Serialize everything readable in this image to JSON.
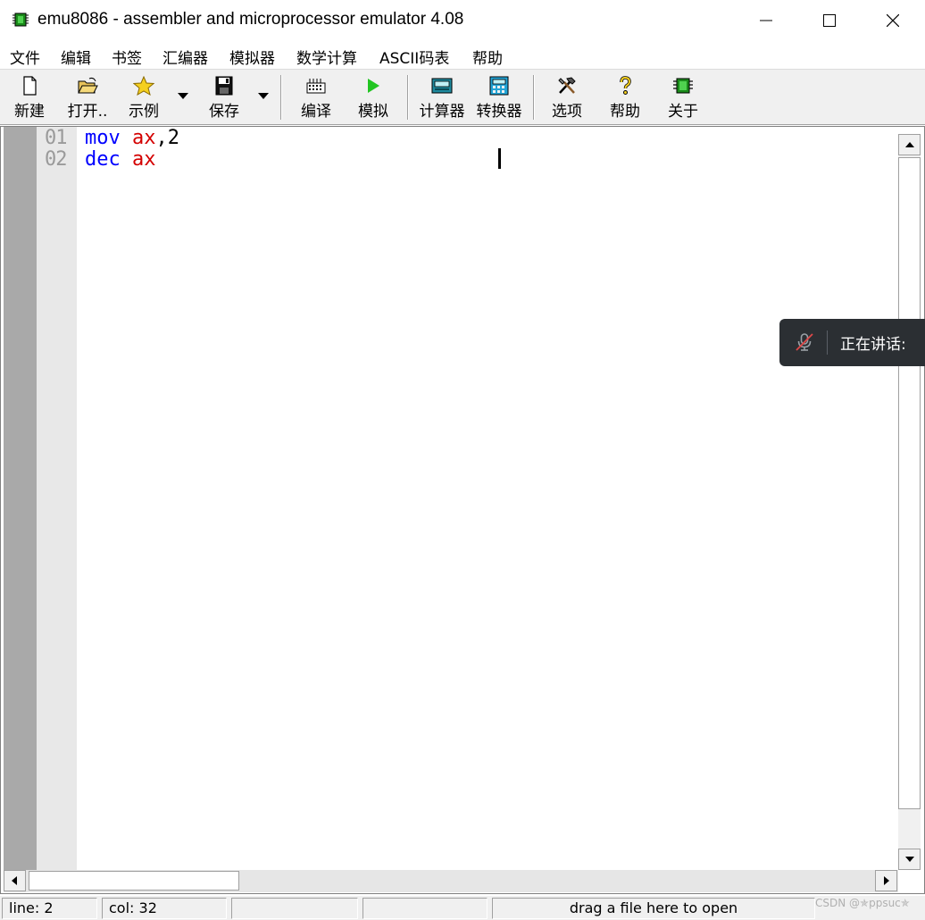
{
  "window": {
    "title": "emu8086 - assembler and microprocessor emulator 4.08"
  },
  "menu": {
    "items": [
      "文件",
      "编辑",
      "书签",
      "汇编器",
      "模拟器",
      "数学计算",
      "ASCII码表",
      "帮助"
    ]
  },
  "toolbar": {
    "new_label": "新建",
    "open_label": "打开..",
    "examples_label": "示例",
    "save_label": "保存",
    "compile_label": "编译",
    "emulate_label": "模拟",
    "calculator_label": "计算器",
    "converter_label": "转换器",
    "options_label": "选项",
    "help_label": "帮助",
    "about_label": "关于"
  },
  "editor": {
    "line_numbers": [
      "01",
      "02"
    ],
    "lines": [
      {
        "keyword": "mov",
        "register": "ax",
        "rest": ",2"
      },
      {
        "keyword": "dec",
        "register": "ax",
        "rest": ""
      }
    ]
  },
  "status": {
    "line": "line: 2",
    "col": "col: 32",
    "hint": "drag a file here to open"
  },
  "overlay": {
    "speaking_text": "正在讲话:"
  },
  "watermark": "CSDN @✯ppsuc✯",
  "colors": {
    "keyword": "#0000ff",
    "register": "#d40000",
    "line_number": "#9a9a9a"
  }
}
